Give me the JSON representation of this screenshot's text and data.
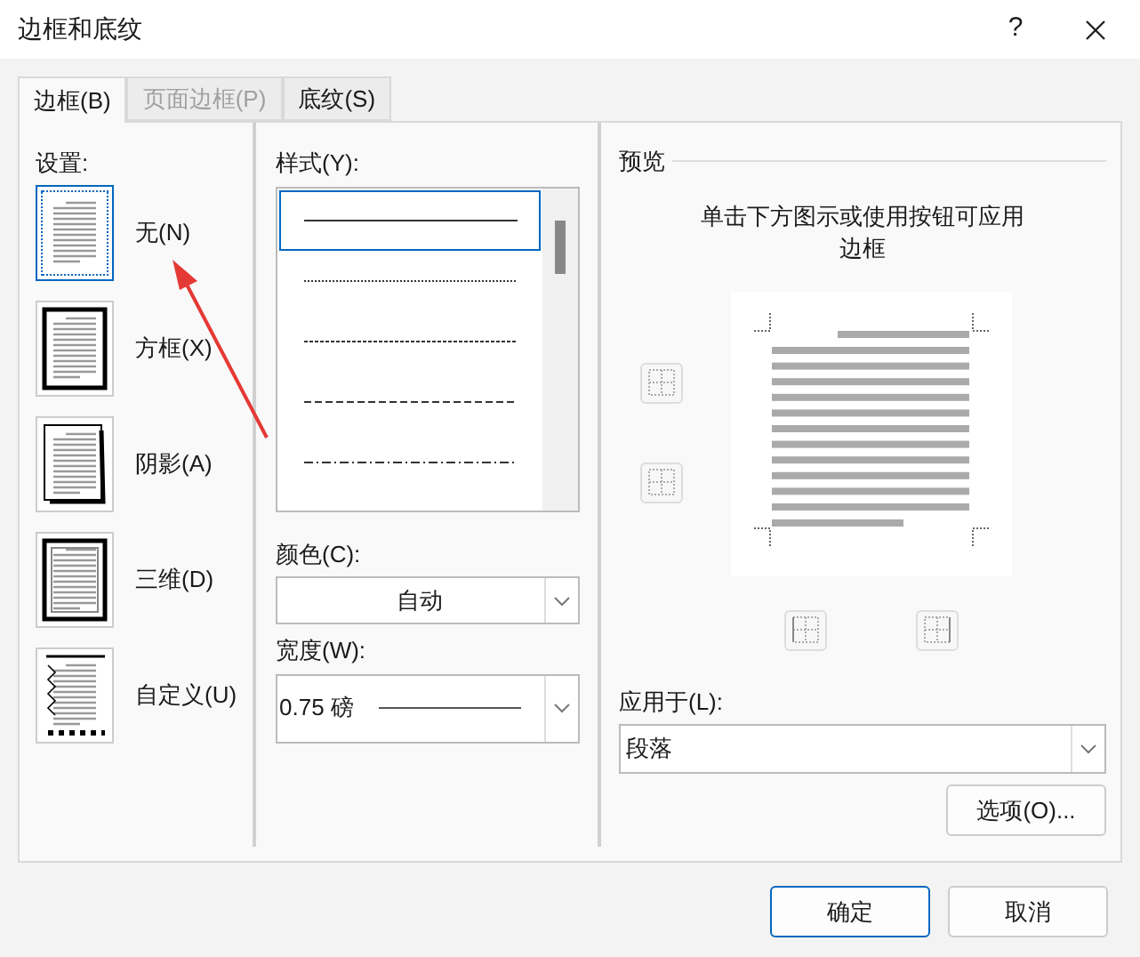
{
  "window": {
    "title": "边框和底纹",
    "help": "?"
  },
  "tabs": [
    {
      "label": "边框(B)",
      "selected": true,
      "disabled": false
    },
    {
      "label": "页面边框(P)",
      "selected": false,
      "disabled": true
    },
    {
      "label": "底纹(S)",
      "selected": false,
      "disabled": false
    }
  ],
  "settings": {
    "label": "设置:",
    "items": [
      {
        "kind": "none",
        "label": "无(N)",
        "selected": true
      },
      {
        "kind": "box",
        "label": "方框(X)",
        "selected": false
      },
      {
        "kind": "shadow",
        "label": "阴影(A)",
        "selected": false
      },
      {
        "kind": "threed",
        "label": "三维(D)",
        "selected": false
      },
      {
        "kind": "custom",
        "label": "自定义(U)",
        "selected": false
      }
    ]
  },
  "style": {
    "label": "样式(Y):",
    "items": [
      {
        "kind": "solid",
        "selected": true
      },
      {
        "kind": "dotted",
        "selected": false
      },
      {
        "kind": "fine-dash",
        "selected": false
      },
      {
        "kind": "dashed",
        "selected": false
      },
      {
        "kind": "dash-dot",
        "selected": false
      }
    ]
  },
  "color": {
    "label": "颜色(C):",
    "value": "自动"
  },
  "width": {
    "label": "宽度(W):",
    "value": "0.75 磅"
  },
  "preview": {
    "label": "预览",
    "hint": "单击下方图示或使用按钮可应用边框"
  },
  "apply_to": {
    "label": "应用于(L):",
    "value": "段落"
  },
  "options_button": "选项(O)...",
  "buttons": [
    "确定",
    "取消"
  ]
}
